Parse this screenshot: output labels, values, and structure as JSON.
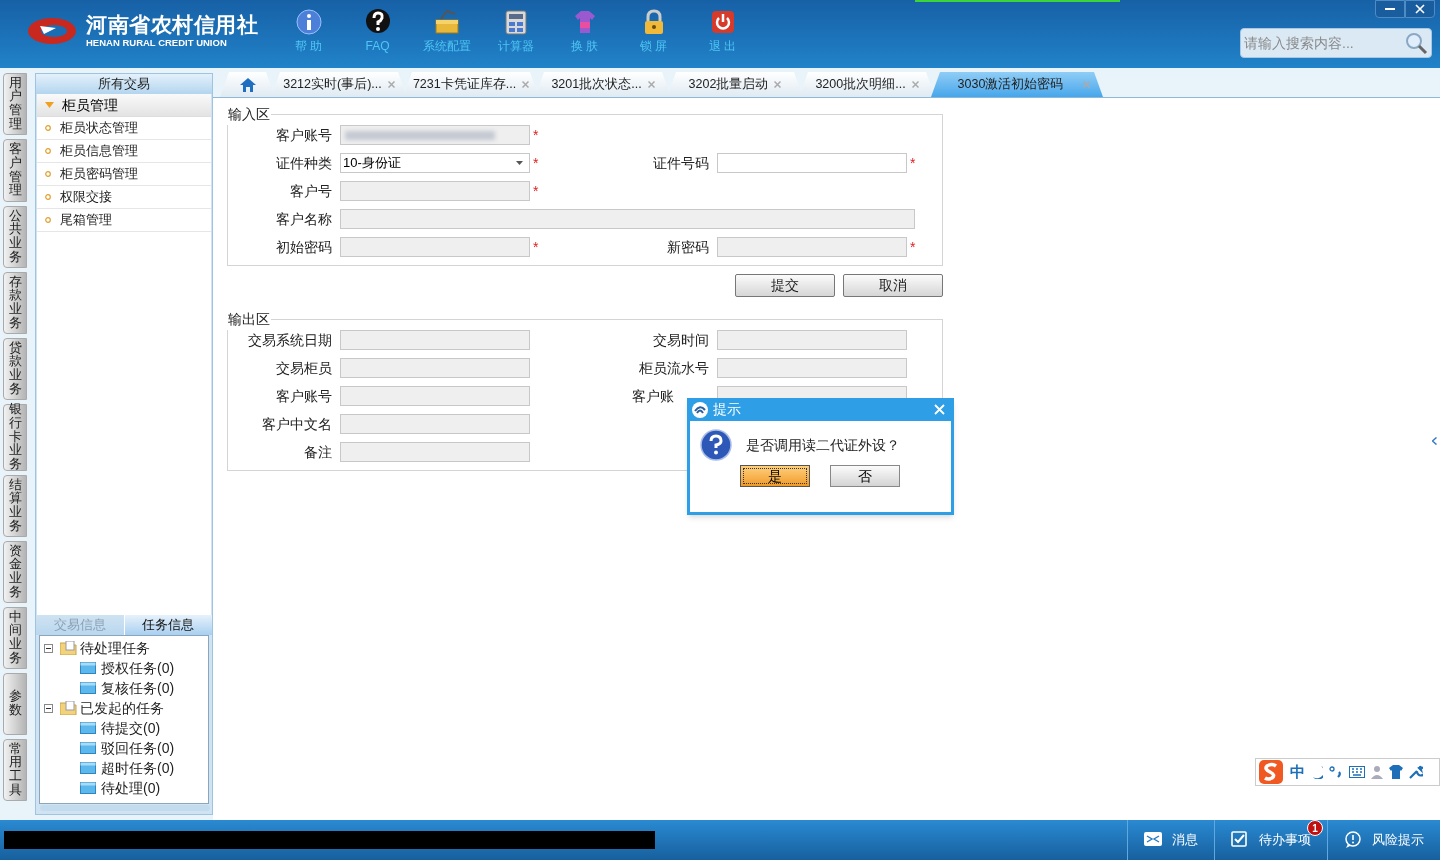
{
  "header": {
    "logo_title": "河南省农村信用社",
    "logo_subtitle": "HENAN RURAL CREDIT UNION",
    "toolbar": [
      {
        "kind": "help",
        "label": "帮 助"
      },
      {
        "kind": "faq",
        "label": "FAQ"
      },
      {
        "kind": "config",
        "label": "系统配置"
      },
      {
        "kind": "calculator",
        "label": "计算器"
      },
      {
        "kind": "skin",
        "label": "换 肤"
      },
      {
        "kind": "lock",
        "label": "锁 屏"
      },
      {
        "kind": "exit",
        "label": "退 出"
      }
    ],
    "search": {
      "placeholder": "请输入搜索内容..."
    }
  },
  "side_tabs": [
    "用户管理",
    "客户管理",
    "公共业务",
    "存款业务",
    "贷款业务",
    "银行卡业务",
    "结算业务",
    "资金业务",
    "中间业务",
    "参数",
    "常用工具"
  ],
  "sidebar": {
    "title": "所有交易",
    "group": {
      "label": "柜员管理",
      "expanded": true,
      "items": [
        "柜员状态管理",
        "柜员信息管理",
        "柜员密码管理",
        "权限交接",
        "尾箱管理"
      ]
    },
    "bottom_tabs": [
      {
        "label": "交易信息",
        "selected": false
      },
      {
        "label": "任务信息",
        "selected": true
      }
    ],
    "task_tree": [
      {
        "label": "待处理任务",
        "expanded": true,
        "children": [
          {
            "label": "授权任务(0)"
          },
          {
            "label": "复核任务(0)"
          }
        ]
      },
      {
        "label": "已发起的任务",
        "expanded": true,
        "children": [
          {
            "label": "待提交(0)"
          },
          {
            "label": "驳回任务(0)"
          },
          {
            "label": "超时任务(0)"
          },
          {
            "label": "待处理(0)"
          }
        ]
      }
    ]
  },
  "tabs": [
    {
      "kind": "home",
      "selected": false
    },
    {
      "label": "3212实时(事后)...",
      "selected": false
    },
    {
      "label": "7231卡凭证库存...",
      "selected": false
    },
    {
      "label": "3201批次状态...",
      "selected": false
    },
    {
      "label": "3202批量启动",
      "selected": false
    },
    {
      "label": "3200批次明细...",
      "selected": false
    },
    {
      "label": "3030激活初始密码",
      "selected": true
    }
  ],
  "input_area": {
    "legend": "输入区",
    "rows": [
      [
        {
          "label": "客户账号",
          "kind": "blurred",
          "disabled": true,
          "mark": "*"
        }
      ],
      [
        {
          "label": "证件种类",
          "kind": "select",
          "value": "10-身份证",
          "disabled": false,
          "mark": "*"
        },
        {
          "label": "证件号码",
          "kind": "text",
          "disabled": false,
          "mark": "*"
        }
      ],
      [
        {
          "label": "客户号",
          "kind": "text",
          "disabled": true,
          "mark": "*"
        }
      ],
      [
        {
          "label": "客户名称",
          "kind": "wide",
          "disabled": true
        }
      ],
      [
        {
          "label": "初始密码",
          "kind": "text",
          "disabled": true,
          "mark": "*"
        },
        {
          "label": "新密码",
          "kind": "text",
          "disabled": true,
          "mark": "*"
        }
      ]
    ]
  },
  "buttons": [
    "提交",
    "取消"
  ],
  "output_area": {
    "legend": "输出区",
    "rows": [
      [
        {
          "label": "交易系统日期",
          "kind": "text",
          "disabled": true
        },
        {
          "label": "交易时间",
          "kind": "text",
          "disabled": true
        }
      ],
      [
        {
          "label": "交易柜员",
          "kind": "text",
          "disabled": true
        },
        {
          "label": "柜员流水号",
          "kind": "text",
          "disabled": true
        }
      ],
      [
        {
          "label": "客户账号",
          "kind": "text",
          "disabled": true
        },
        {
          "label": "客户账",
          "kind": "covered",
          "disabled": true
        }
      ],
      [
        {
          "label": "客户中文名",
          "kind": "text",
          "disabled": true
        }
      ],
      [
        {
          "label": "备注",
          "kind": "text",
          "disabled": true
        }
      ]
    ]
  },
  "dialog": {
    "title": "提示",
    "message": "是否调用读二代证外设？",
    "buttons": [
      {
        "label": "是",
        "selected": true
      },
      {
        "label": "否",
        "selected": false
      }
    ]
  },
  "ime_toolbar": {
    "mode": "中"
  },
  "status_bar": [
    {
      "kind": "message",
      "label": "消息"
    },
    {
      "kind": "todo",
      "label": "待办事项",
      "badge": "1"
    },
    {
      "kind": "risk",
      "label": "风险提示"
    }
  ]
}
